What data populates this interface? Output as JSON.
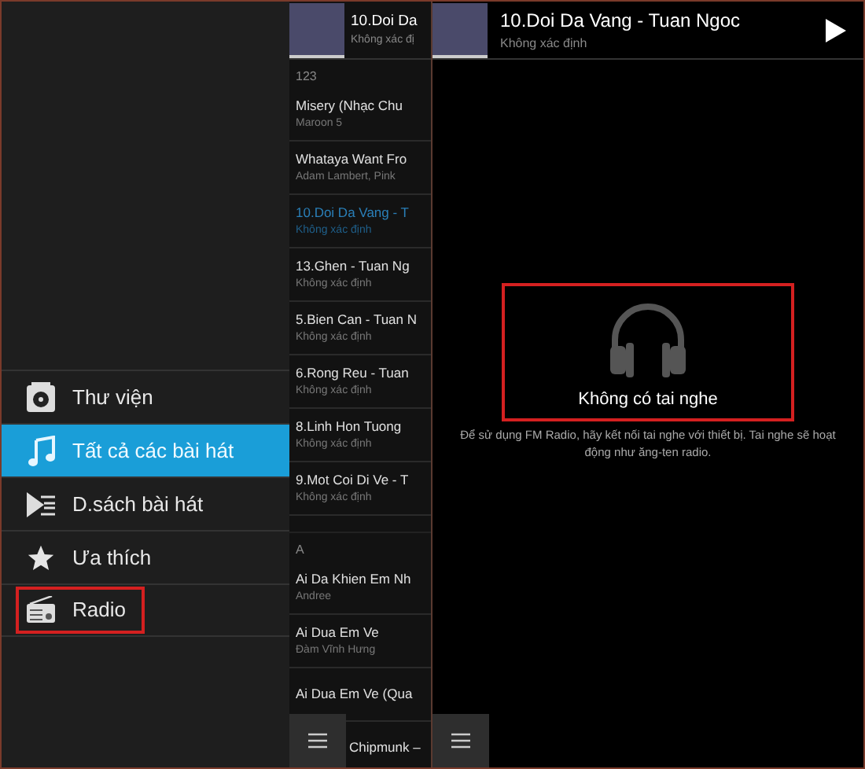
{
  "menu": {
    "items": [
      {
        "kind": "library",
        "label": "Thư viện",
        "selected": false,
        "highlighted": false
      },
      {
        "kind": "songs",
        "label": "Tất cả các bài hát",
        "selected": true,
        "highlighted": false
      },
      {
        "kind": "playlists",
        "label": "D.sách bài hát",
        "selected": false,
        "highlighted": false
      },
      {
        "kind": "favorites",
        "label": "Ưa thích",
        "selected": false,
        "highlighted": false
      },
      {
        "kind": "radio",
        "label": "Radio",
        "selected": false,
        "highlighted": true
      }
    ]
  },
  "song_list": {
    "now_playing": {
      "title": "10.Doi Da",
      "subtitle": "Không xác đị"
    },
    "sections": [
      {
        "header": "123",
        "songs": [
          {
            "title": "Misery (Nhạc Chu",
            "subtitle": "Maroon 5",
            "selected": false
          },
          {
            "title": "Whataya Want Fro",
            "subtitle": "Adam Lambert, Pink",
            "selected": false
          },
          {
            "title": "10.Doi Da Vang - T",
            "subtitle": "Không xác định",
            "selected": true
          },
          {
            "title": "13.Ghen - Tuan Ng",
            "subtitle": "Không xác định",
            "selected": false
          },
          {
            "title": "5.Bien Can - Tuan N",
            "subtitle": "Không xác định",
            "selected": false
          },
          {
            "title": "6.Rong Reu - Tuan",
            "subtitle": "Không xác định",
            "selected": false
          },
          {
            "title": "8.Linh Hon Tuong",
            "subtitle": "Không xác định",
            "selected": false
          },
          {
            "title": "9.Mot Coi Di Ve - T",
            "subtitle": "Không xác định",
            "selected": false
          }
        ]
      },
      {
        "header": "A",
        "songs": [
          {
            "title": "Ai Da Khien Em Nh",
            "subtitle": "Andree",
            "selected": false
          },
          {
            "title": "Ai Dua Em Ve",
            "subtitle": "Đàm Vĩnh Hưng",
            "selected": false
          },
          {
            "title": "Ai Dua Em Ve (Qua",
            "selected": false
          },
          {
            "title": "Chipmunk –",
            "selected": false
          }
        ]
      }
    ]
  },
  "radio": {
    "now_playing": {
      "title": "10.Doi Da Vang - Tuan Ngoc",
      "subtitle": "Không xác định"
    },
    "empty_state": {
      "title": "Không có tai nghe",
      "description": "Để sử dụng FM Radio, hãy kết nối tai nghe với thiết bị. Tai nghe sẽ hoạt động như ăng-ten radio.",
      "highlighted": true
    }
  }
}
